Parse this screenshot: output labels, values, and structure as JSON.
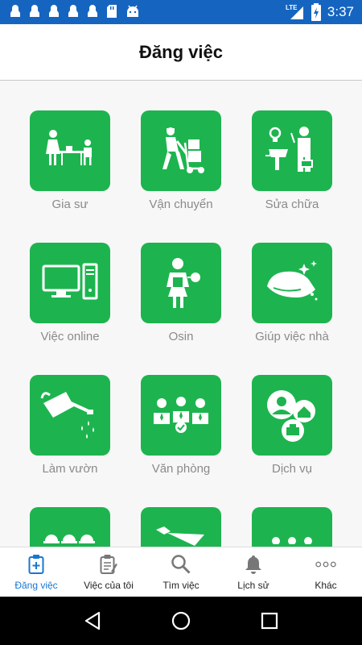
{
  "status_bar": {
    "time": "3:37",
    "network": "LTE",
    "icons": [
      "notification-icon",
      "notification-icon",
      "notification-icon",
      "notification-icon",
      "notification-icon",
      "sd-card-icon",
      "android-icon",
      "lte-signal-icon",
      "battery-charging-icon"
    ]
  },
  "appbar": {
    "title": "Đăng việc"
  },
  "categories": [
    {
      "label": "Gia sư",
      "icon": "tutor-icon"
    },
    {
      "label": "Vận chuyển",
      "icon": "delivery-icon"
    },
    {
      "label": "Sửa chữa",
      "icon": "repair-icon"
    },
    {
      "label": "Việc online",
      "icon": "computer-icon"
    },
    {
      "label": "Osin",
      "icon": "housemaid-icon"
    },
    {
      "label": "Giúp việc nhà",
      "icon": "cleaning-icon"
    },
    {
      "label": "Làm vườn",
      "icon": "watering-can-icon"
    },
    {
      "label": "Văn phòng",
      "icon": "office-team-icon"
    },
    {
      "label": "Dịch vụ",
      "icon": "services-icon"
    }
  ],
  "bottom_nav": [
    {
      "label": "Đăng việc",
      "icon": "post-job-icon",
      "active": true
    },
    {
      "label": "Việc của tôi",
      "icon": "my-jobs-icon",
      "active": false
    },
    {
      "label": "Tìm việc",
      "icon": "search-icon",
      "active": false
    },
    {
      "label": "Lịch sử",
      "icon": "bell-icon",
      "active": false
    },
    {
      "label": "Khác",
      "icon": "more-icon",
      "active": false
    }
  ],
  "colors": {
    "status_bar": "#1565c0",
    "tile_green": "#1db44f",
    "active_nav": "#1976d2",
    "label_gray": "#8a8a8a"
  }
}
